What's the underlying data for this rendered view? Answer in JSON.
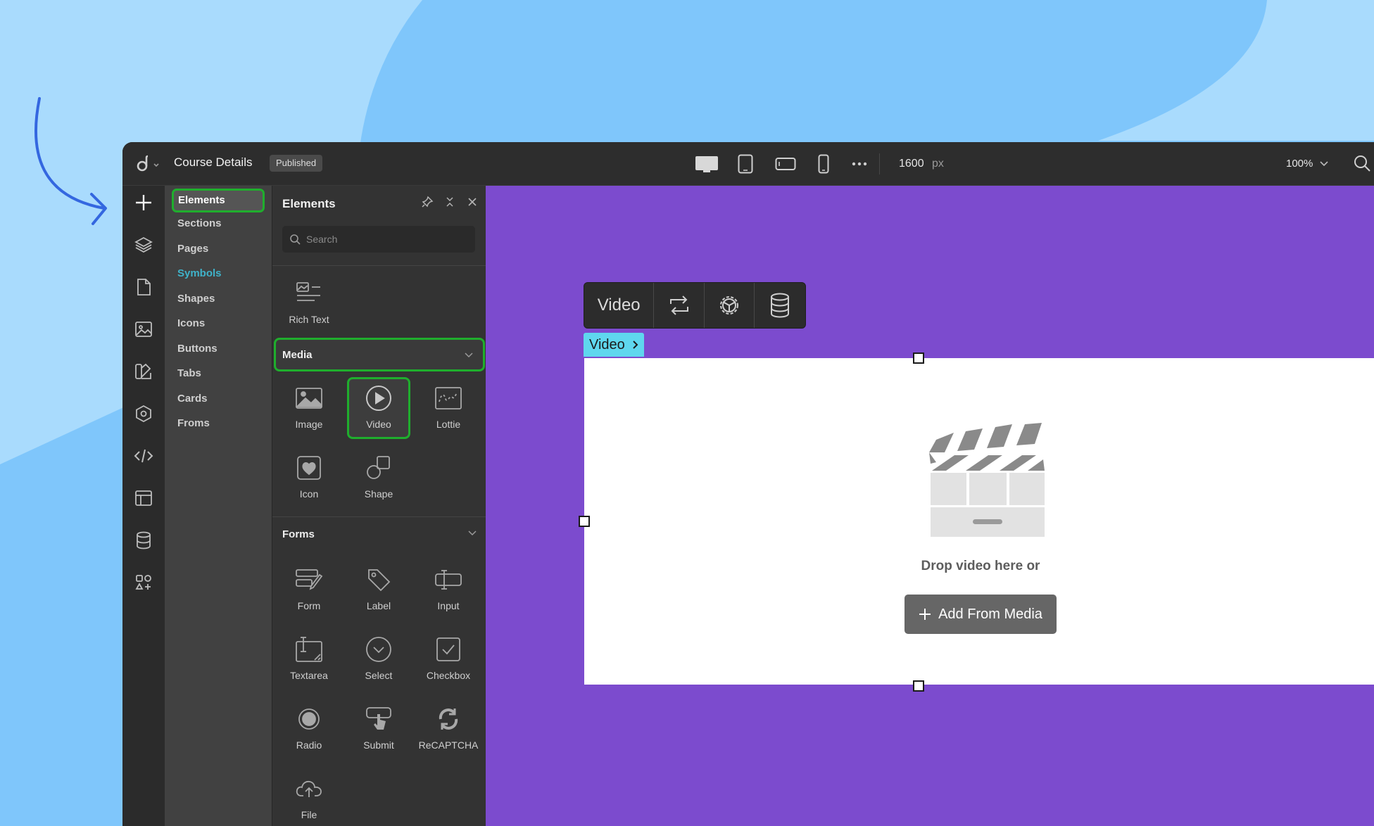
{
  "header": {
    "doc_title": "Course Details",
    "status_badge": "Published",
    "width_value": "1600",
    "width_unit": "px",
    "zoom": "100%"
  },
  "categories": {
    "items": [
      {
        "label": "Elements",
        "active": true
      },
      {
        "label": "Sections"
      },
      {
        "label": "Pages"
      },
      {
        "label": "Symbols"
      },
      {
        "label": "Shapes"
      },
      {
        "label": "Icons"
      },
      {
        "label": "Buttons"
      },
      {
        "label": "Tabs"
      },
      {
        "label": "Cards"
      },
      {
        "label": "Froms"
      }
    ]
  },
  "panel": {
    "title": "Elements",
    "search_placeholder": "Search",
    "rich_text_label": "Rich Text",
    "media": {
      "title": "Media",
      "items": [
        "Image",
        "Video",
        "Lottie",
        "Icon",
        "Shape"
      ],
      "selected": "Video"
    },
    "forms": {
      "title": "Forms",
      "items": [
        "Form",
        "Label",
        "Input",
        "Textarea",
        "Select",
        "Checkbox",
        "Radio",
        "Submit",
        "ReCAPTCHA",
        "File"
      ]
    }
  },
  "canvas": {
    "context_label": "Video",
    "breadcrumb": "Video",
    "drop_text": "Drop video here or",
    "add_button": "Add From Media"
  },
  "colors": {
    "canvas_bg": "#7c4bce",
    "highlight": "#1fae2d",
    "breadcrumb_bg": "#5fd7ee",
    "symbols_link": "#3fb2c9",
    "page_bg": "#7fc6fb"
  }
}
